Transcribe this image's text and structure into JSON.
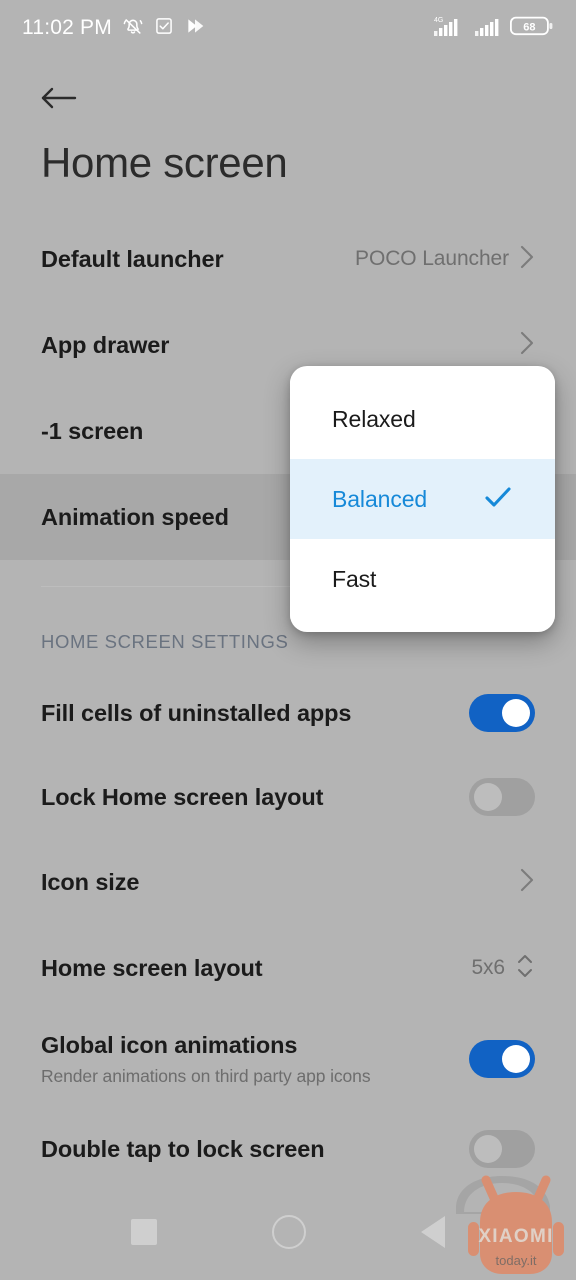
{
  "statusbar": {
    "time": "11:02 PM",
    "icons": [
      "bell-muted-icon",
      "checkbox-task-icon",
      "double-chevron-icon"
    ],
    "network_label": "4G",
    "signal_icons": [
      "signal-bars-icon",
      "signal-bars-secondary-icon"
    ],
    "battery_level": "68"
  },
  "appbar": {
    "back_icon": "arrow-left-icon",
    "title": "Home screen"
  },
  "settings": {
    "rows": [
      {
        "title": "Default launcher",
        "value": "POCO Launcher",
        "accessory": "chevron"
      },
      {
        "title": "App drawer",
        "value": "",
        "accessory": "chevron"
      },
      {
        "title": "-1 screen",
        "value": "",
        "accessory": "none"
      },
      {
        "title": "Animation speed",
        "value": "",
        "accessory": "none",
        "pressed": true
      }
    ],
    "section_header": "HOME SCREEN SETTINGS",
    "section_rows": [
      {
        "title": "Fill cells of uninstalled apps",
        "sub": "",
        "accessory": "toggle",
        "toggle_on": true
      },
      {
        "title": "Lock Home screen layout",
        "sub": "",
        "accessory": "toggle",
        "toggle_on": false
      },
      {
        "title": "Icon size",
        "sub": "",
        "accessory": "chevron"
      },
      {
        "title": "Home screen layout",
        "sub": "",
        "value": "5x6",
        "accessory": "stepper"
      },
      {
        "title": "Global icon animations",
        "sub": "Render animations on third party app icons",
        "accessory": "toggle",
        "toggle_on": true
      },
      {
        "title": "Double tap to lock screen",
        "sub": "",
        "accessory": "toggle-partial",
        "toggle_on": false
      }
    ]
  },
  "dialog": {
    "options": [
      {
        "label": "Relaxed",
        "selected": false
      },
      {
        "label": "Balanced",
        "selected": true
      },
      {
        "label": "Fast",
        "selected": false
      }
    ],
    "check_icon": "check-icon"
  },
  "navbar": {
    "recents": "recents-square-icon",
    "home": "home-circle-icon",
    "back": "back-triangle-icon"
  },
  "watermark": {
    "brand": "XIAOMI",
    "site": "today.it"
  },
  "colors": {
    "background": "#b4b4b4",
    "accent_blue": "#1689d8",
    "toggle_on": "#1162c4",
    "dialog_selected_bg": "#e3f1fb",
    "section_header": "#6a7380",
    "watermark_orange": "#e8825a"
  }
}
